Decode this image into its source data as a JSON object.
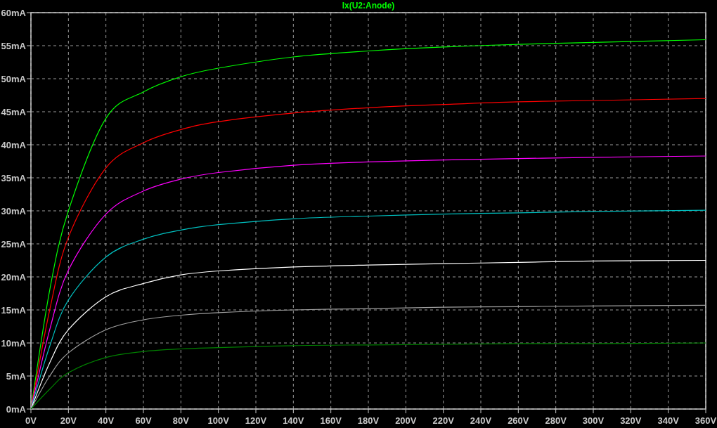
{
  "chart_data": {
    "type": "line",
    "title": "Ix(U2:Anode)",
    "grid": true,
    "x": [
      0,
      10,
      20,
      40,
      60,
      80,
      100,
      140,
      180,
      220,
      260,
      300,
      360
    ],
    "series": [
      {
        "color": "#00ff00",
        "values": [
          0,
          18,
          30,
          44,
          48,
          50.3,
          51.6,
          53.3,
          54.2,
          54.8,
          55.2,
          55.5,
          55.9
        ]
      },
      {
        "color": "#ff0000",
        "values": [
          0,
          15,
          26,
          36.5,
          40.3,
          42.3,
          43.5,
          44.8,
          45.6,
          46.1,
          46.5,
          46.7,
          47
        ]
      },
      {
        "color": "#ff00ff",
        "values": [
          0,
          12,
          21,
          29.5,
          33,
          34.8,
          35.8,
          36.9,
          37.4,
          37.7,
          37.9,
          38.1,
          38.3
        ]
      },
      {
        "color": "#00c0c0",
        "values": [
          0,
          9.5,
          16.5,
          23,
          25.7,
          27.1,
          27.9,
          28.8,
          29.2,
          29.5,
          29.7,
          29.9,
          30.1
        ]
      },
      {
        "color": "#ffffff",
        "values": [
          0,
          7,
          12,
          17,
          19,
          20.3,
          20.9,
          21.5,
          21.8,
          22,
          22.2,
          22.4,
          22.5
        ]
      },
      {
        "color": "#a0a0a0",
        "values": [
          0,
          5,
          8.5,
          12,
          13.5,
          14.2,
          14.6,
          15,
          15.2,
          15.4,
          15.5,
          15.6,
          15.7
        ]
      },
      {
        "color": "#008000",
        "values": [
          0,
          3,
          5.5,
          7.8,
          8.7,
          9.1,
          9.3,
          9.6,
          9.7,
          9.8,
          9.9,
          9.9,
          10
        ]
      }
    ],
    "xlim": [
      0,
      360
    ],
    "ylim": [
      0,
      60
    ],
    "xticks": [
      {
        "value": 0,
        "label": "0V"
      },
      {
        "value": 20,
        "label": "20V"
      },
      {
        "value": 40,
        "label": "40V"
      },
      {
        "value": 60,
        "label": "60V"
      },
      {
        "value": 80,
        "label": "80V"
      },
      {
        "value": 100,
        "label": "100V"
      },
      {
        "value": 120,
        "label": "120V"
      },
      {
        "value": 140,
        "label": "140V"
      },
      {
        "value": 160,
        "label": "160V"
      },
      {
        "value": 180,
        "label": "180V"
      },
      {
        "value": 200,
        "label": "200V"
      },
      {
        "value": 220,
        "label": "220V"
      },
      {
        "value": 240,
        "label": "240V"
      },
      {
        "value": 260,
        "label": "260V"
      },
      {
        "value": 280,
        "label": "280V"
      },
      {
        "value": 300,
        "label": "300V"
      },
      {
        "value": 320,
        "label": "320V"
      },
      {
        "value": 340,
        "label": "340V"
      },
      {
        "value": 360,
        "label": "360V"
      }
    ],
    "yticks": [
      {
        "value": 0,
        "label": "0mA"
      },
      {
        "value": 5,
        "label": "5mA"
      },
      {
        "value": 10,
        "label": "10mA"
      },
      {
        "value": 15,
        "label": "15mA"
      },
      {
        "value": 20,
        "label": "20mA"
      },
      {
        "value": 25,
        "label": "25mA"
      },
      {
        "value": 30,
        "label": "30mA"
      },
      {
        "value": 35,
        "label": "35mA"
      },
      {
        "value": 40,
        "label": "40mA"
      },
      {
        "value": 45,
        "label": "45mA"
      },
      {
        "value": 50,
        "label": "50mA"
      },
      {
        "value": 55,
        "label": "55mA"
      },
      {
        "value": 60,
        "label": "60mA"
      }
    ]
  }
}
